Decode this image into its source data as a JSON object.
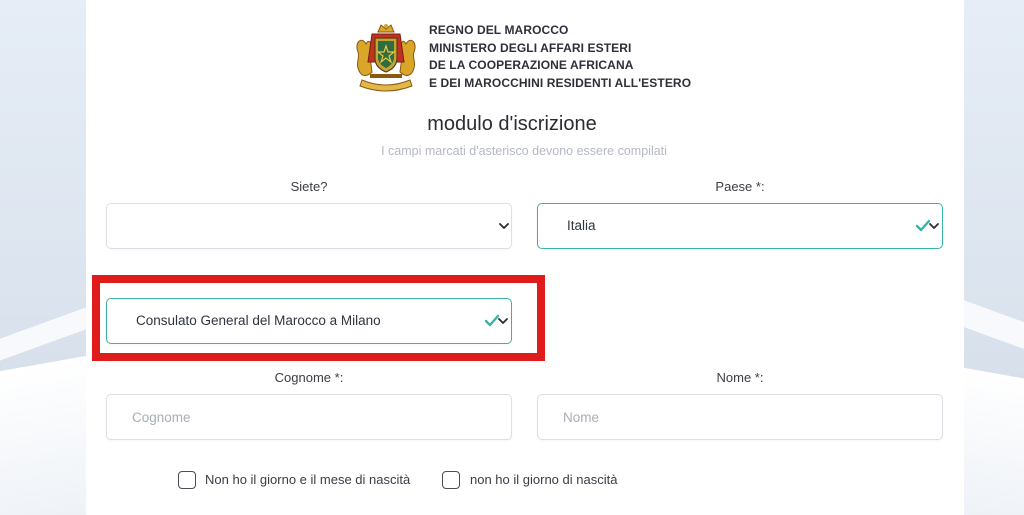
{
  "ministry": {
    "lines": [
      "REGNO DEL MAROCCO",
      "MINISTERO DEGLI AFFARI ESTERI",
      "DE LA COOPERAZIONE AFRICANA",
      "E DEI MAROCCHINI RESIDENTI ALL'ESTERO"
    ]
  },
  "form": {
    "title": "modulo d'iscrizione",
    "subtitle": "I campi marcati d'asterisco devono essere compilati",
    "siete": {
      "label": "Siete?",
      "value": ""
    },
    "paese": {
      "label": "Paese *:",
      "value": "Italia"
    },
    "consolato": {
      "value": "Consulato General del Marocco a Milano"
    },
    "cognome": {
      "label": "Cognome *:",
      "placeholder": "Cognome"
    },
    "nome": {
      "label": "Nome *:",
      "placeholder": "Nome"
    },
    "checkboxes": [
      {
        "label": "Non ho il giorno e il mese di nascità",
        "checked": false
      },
      {
        "label": "non ho il giorno di nascità",
        "checked": false
      }
    ]
  },
  "colors": {
    "valid_border": "#3bb3a2",
    "highlight": "#e01b1b",
    "check": "#3bb3a2"
  },
  "icons": [
    "coat-of-arms-emblem",
    "chevron-down-icon",
    "valid-check-icon",
    "checkbox-icon"
  ]
}
